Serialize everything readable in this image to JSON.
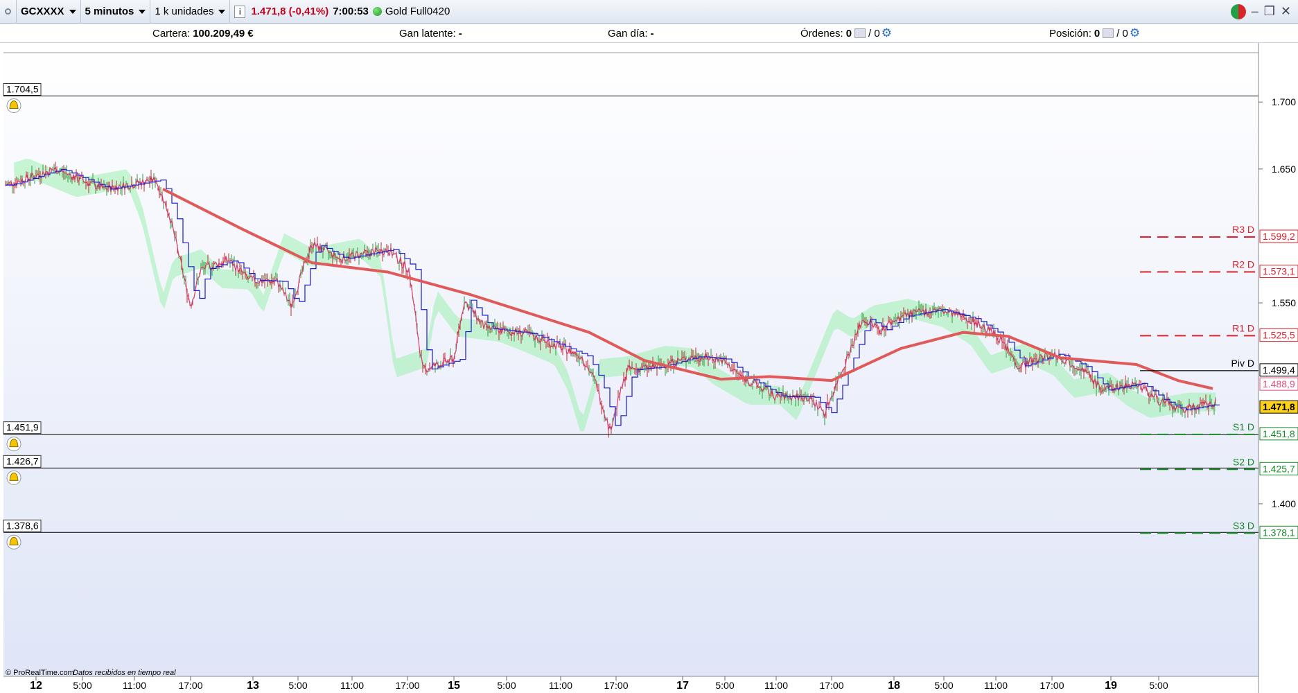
{
  "toolbar": {
    "symbol": "GCXXXX",
    "timeframe": "5 minutos",
    "units": "1 k unidades",
    "info_icon": "info-icon",
    "last_price": "1.471,8 (-0,41%)",
    "time": "7:00:53",
    "status_color": "#2aa02a",
    "instrument": "Gold Full0420",
    "controls": [
      "sync-icon",
      "minimize-icon",
      "restore-icon",
      "close-icon"
    ]
  },
  "account": {
    "cartera_label": "Cartera:",
    "cartera_value": "100.209,49 €",
    "gan_latente_label": "Gan latente:",
    "gan_latente_value": "-",
    "gan_dia_label": "Gan día:",
    "gan_dia_value": "-",
    "ordenes_label": "Órdenes:",
    "ordenes_a": "0",
    "ordenes_b": "/ 0",
    "posicion_label": "Posición:",
    "posicion_a": "0",
    "posicion_b": "/ 0"
  },
  "chart": {
    "footer_source": "© ProRealTime.com",
    "footer_status": "Datos recibidos en tiempo real",
    "y_ticks": [
      "1.700",
      "1.650",
      "1.550",
      "1.400"
    ],
    "x_ticks": [
      {
        "label": "12",
        "bold": true
      },
      {
        "label": "5:00"
      },
      {
        "label": "11:00"
      },
      {
        "label": "17:00"
      },
      {
        "label": "13",
        "bold": true
      },
      {
        "label": "5:00"
      },
      {
        "label": "11:00"
      },
      {
        "label": "17:00"
      },
      {
        "label": "15",
        "bold": true
      },
      {
        "label": "5:00"
      },
      {
        "label": "11:00"
      },
      {
        "label": "17:00"
      },
      {
        "label": "17",
        "bold": true
      },
      {
        "label": "5:00"
      },
      {
        "label": "11:00"
      },
      {
        "label": "17:00"
      },
      {
        "label": "18",
        "bold": true
      },
      {
        "label": "5:00"
      },
      {
        "label": "11:00"
      },
      {
        "label": "17:00"
      },
      {
        "label": "19",
        "bold": true
      },
      {
        "label": "5:00"
      }
    ],
    "alert_lines": [
      "1.704,5",
      "1.451,9",
      "1.426,7",
      "1.378,6"
    ],
    "pivots": [
      {
        "name": "R3 D",
        "value": "1.599,2",
        "color": "#e0202a"
      },
      {
        "name": "R2 D",
        "value": "1.573,1",
        "color": "#e0202a"
      },
      {
        "name": "R1 D",
        "value": "1.525,5",
        "color": "#e0202a"
      },
      {
        "name": "Piv D",
        "value": "1.499,4",
        "color": "#000000"
      },
      {
        "name": "S1 D",
        "value": "1.451,8",
        "color": "#1a8a2a"
      },
      {
        "name": "S2 D",
        "value": "1.425,7",
        "color": "#1a8a2a"
      },
      {
        "name": "S3 D",
        "value": "1.378,1",
        "color": "#1a8a2a"
      }
    ],
    "extra_labels": [
      {
        "value": "1.488,9",
        "color": "#e0507a"
      },
      {
        "value": "1.471,8",
        "color": "#000000",
        "bg": "#ffd21a"
      }
    ],
    "colors": {
      "price": "#d63b6a",
      "fast": "#1a1acc",
      "ma": "#e05a5a",
      "cloud": "#9df0b0",
      "cloud2": "#b8f3f0"
    }
  }
}
